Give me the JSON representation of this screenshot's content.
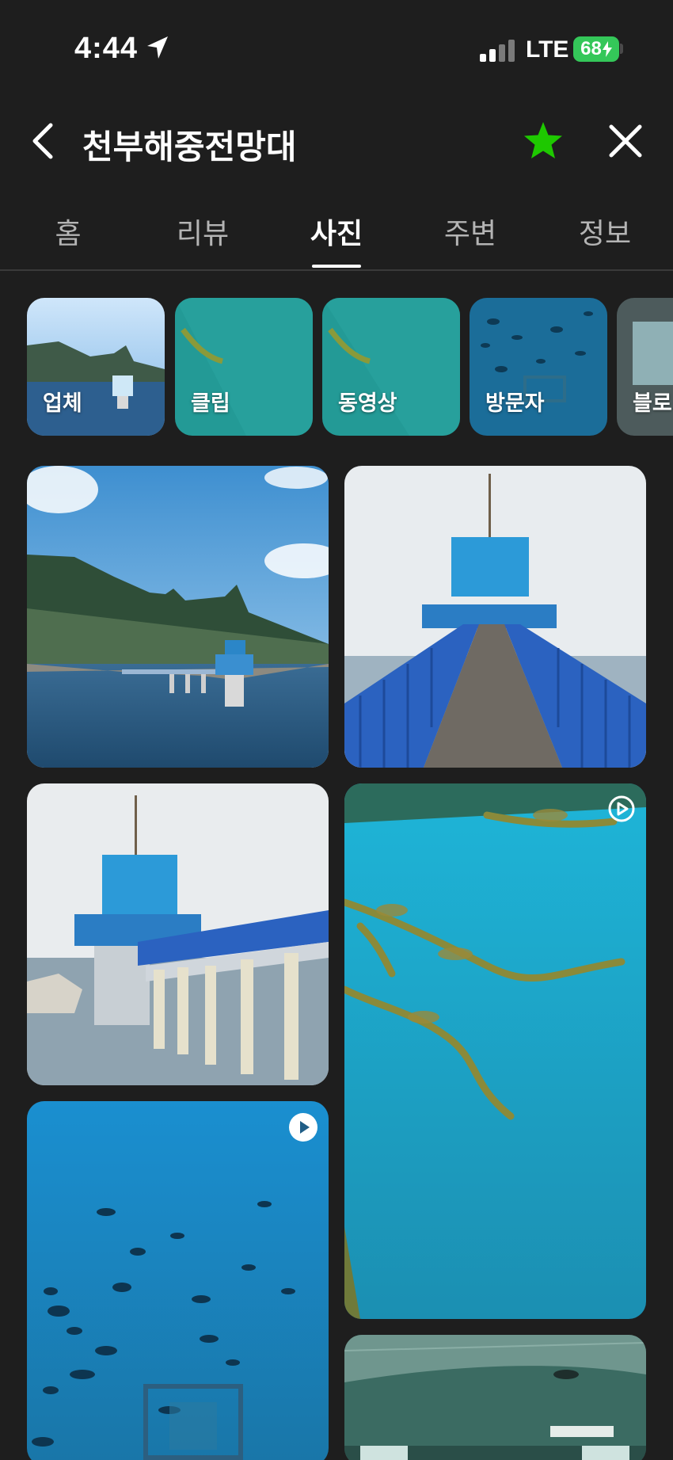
{
  "status_bar": {
    "time": "4:44",
    "network": "LTE",
    "battery": "68"
  },
  "header": {
    "title": "천부해중전망대",
    "back_icon": "chevron-left-icon",
    "favorite_icon": "star-icon",
    "close_icon": "close-icon",
    "favorite_color": "#1ec800"
  },
  "tabs": [
    {
      "label": "홈"
    },
    {
      "label": "리뷰"
    },
    {
      "label": "사진",
      "active": true
    },
    {
      "label": "주변"
    },
    {
      "label": "정보"
    }
  ],
  "categories": [
    {
      "label": "업체"
    },
    {
      "label": "클립"
    },
    {
      "label": "동영상"
    },
    {
      "label": "방문자"
    },
    {
      "label": "블로"
    }
  ],
  "photos": [
    {
      "subject": "coastal-pier-observatory"
    },
    {
      "subject": "bridge-to-observatory"
    },
    {
      "subject": "observatory-tower-side"
    },
    {
      "subject": "underwater-seaweed",
      "badge": "clip-play-icon"
    },
    {
      "subject": "underwater-fish",
      "badge": "video-play-icon"
    },
    {
      "subject": "observatory-interior"
    }
  ]
}
